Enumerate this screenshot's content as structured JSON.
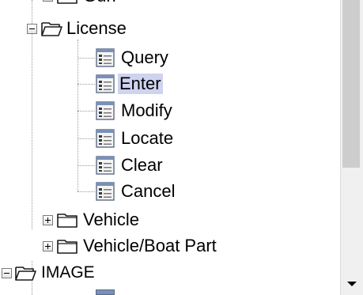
{
  "tree": {
    "partial_top_label": "Gun",
    "license": {
      "label": "License",
      "children": [
        "Query",
        "Enter",
        "Modify",
        "Locate",
        "Clear",
        "Cancel"
      ],
      "selected_child": "Enter"
    },
    "vehicle_label": "Vehicle",
    "boat_part_label": "Vehicle/Boat Part",
    "image_label": "IMAGE"
  },
  "icons": {
    "folder": "folder-icon",
    "open_folder": "folder-open-icon",
    "document": "form-document-icon",
    "expand": "plus-expander-icon",
    "collapse": "minus-expander-icon"
  },
  "colors": {
    "selection_bg": "#cfd3ee",
    "tree_lines": "#9a9a9a",
    "scroll_thumb": "#cdcdcd",
    "scroll_track": "#f0f0f0"
  }
}
